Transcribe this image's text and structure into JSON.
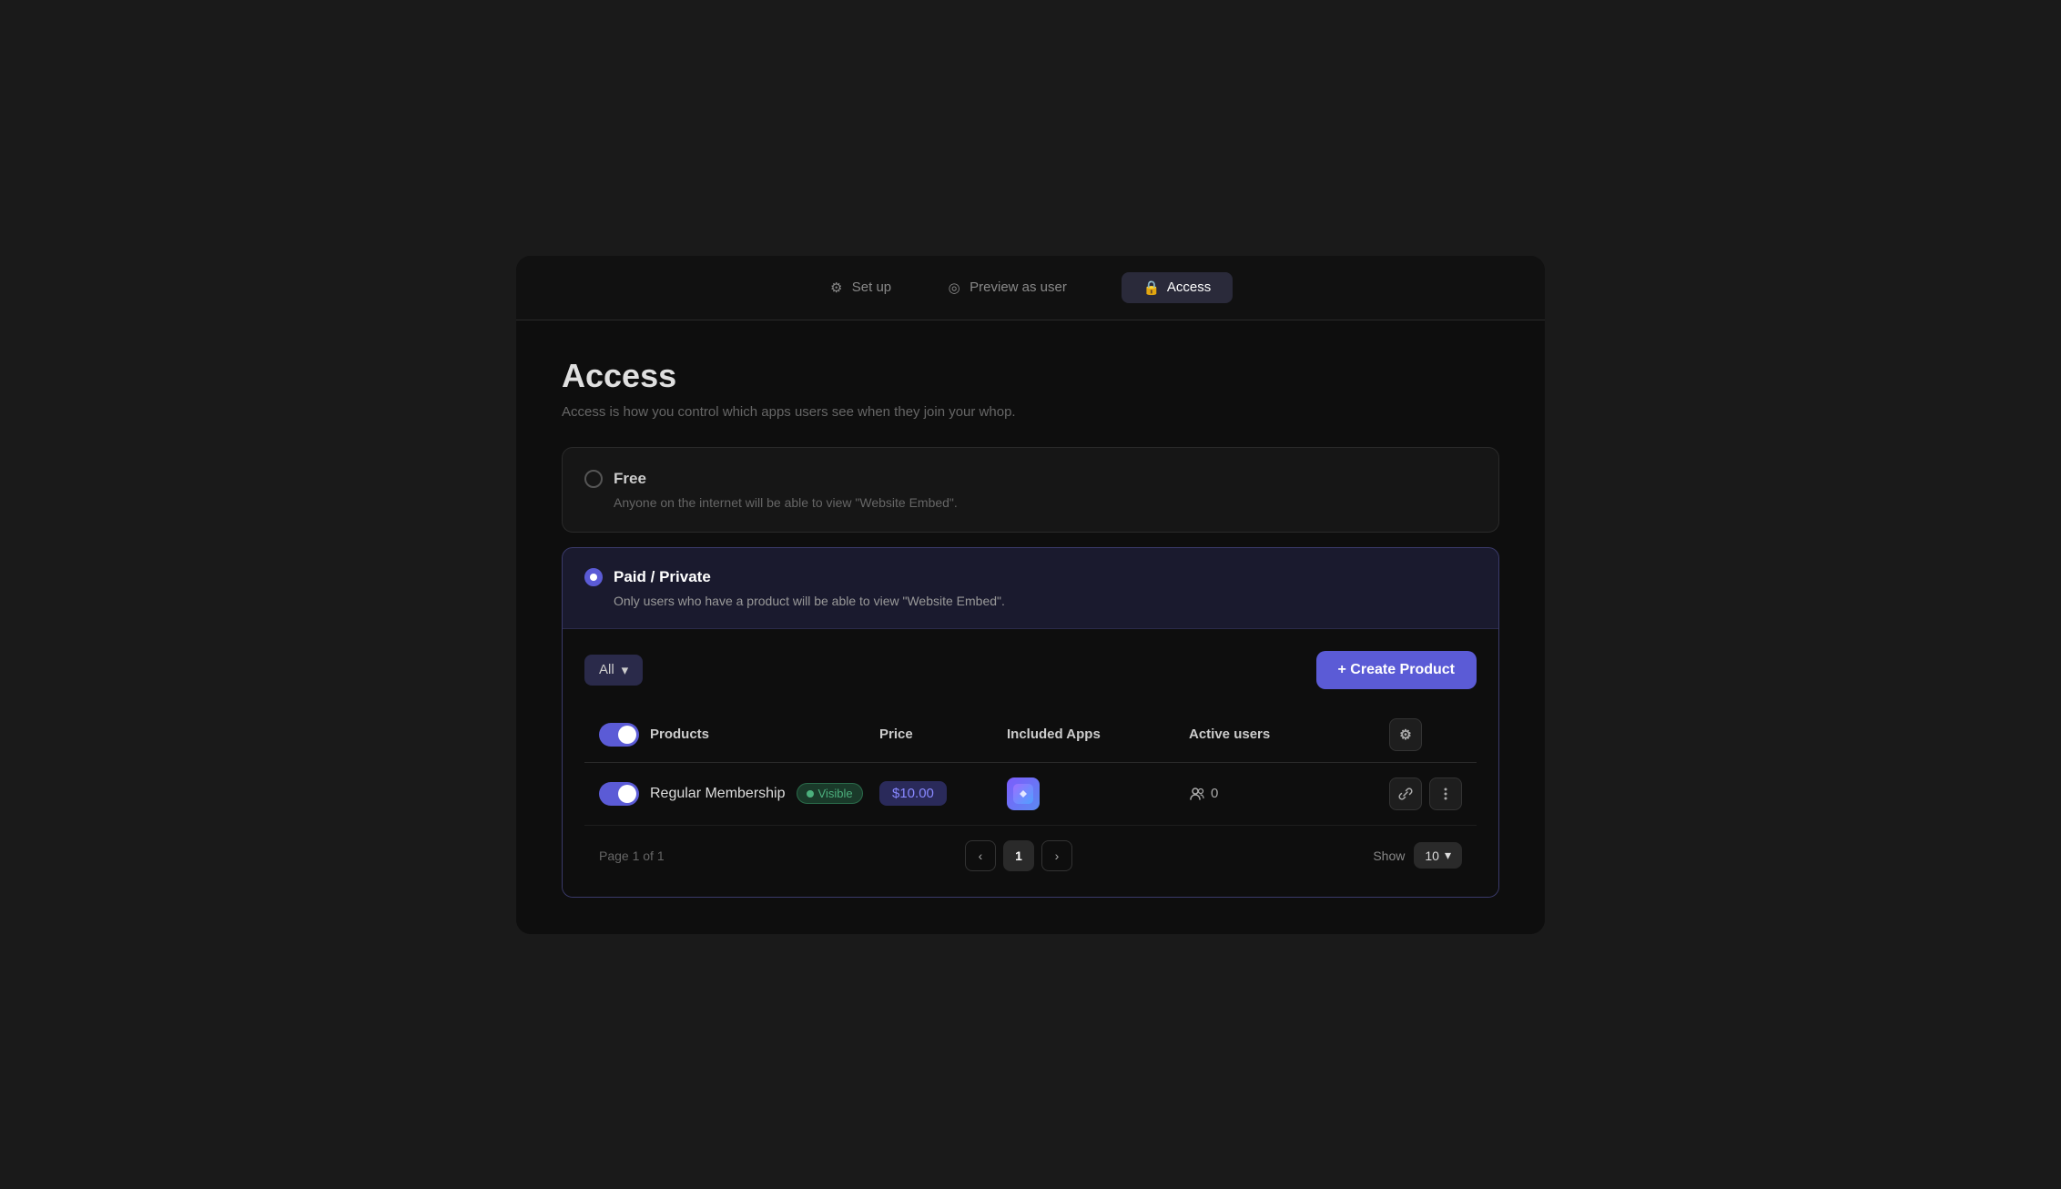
{
  "nav": {
    "items": [
      {
        "id": "setup",
        "label": "Set up",
        "icon": "⚙"
      },
      {
        "id": "preview",
        "label": "Preview as user",
        "icon": "◎"
      },
      {
        "id": "access",
        "label": "Access",
        "icon": "🔒",
        "active": true
      }
    ]
  },
  "header": {
    "title": "Access",
    "subtitle": "Access is how you control which apps users see when they join your whop."
  },
  "free_option": {
    "label": "Free",
    "description": "Anyone on the internet will be able to view \"Website Embed\"."
  },
  "paid_option": {
    "label": "Paid / Private",
    "description": "Only users who have a product will be able to view \"Website Embed\".",
    "selected": true
  },
  "filter": {
    "label": "All"
  },
  "create_btn": {
    "label": "+ Create Product"
  },
  "table": {
    "columns": {
      "products": "Products",
      "price": "Price",
      "included_apps": "Included Apps",
      "active_users": "Active users"
    },
    "rows": [
      {
        "name": "Regular Membership",
        "visible": true,
        "visible_label": "Visible",
        "price": "$10.00",
        "active_users": 0
      }
    ]
  },
  "pagination": {
    "page_info": "Page 1 of 1",
    "current_page": "1",
    "show_label": "Show",
    "show_value": "10"
  }
}
